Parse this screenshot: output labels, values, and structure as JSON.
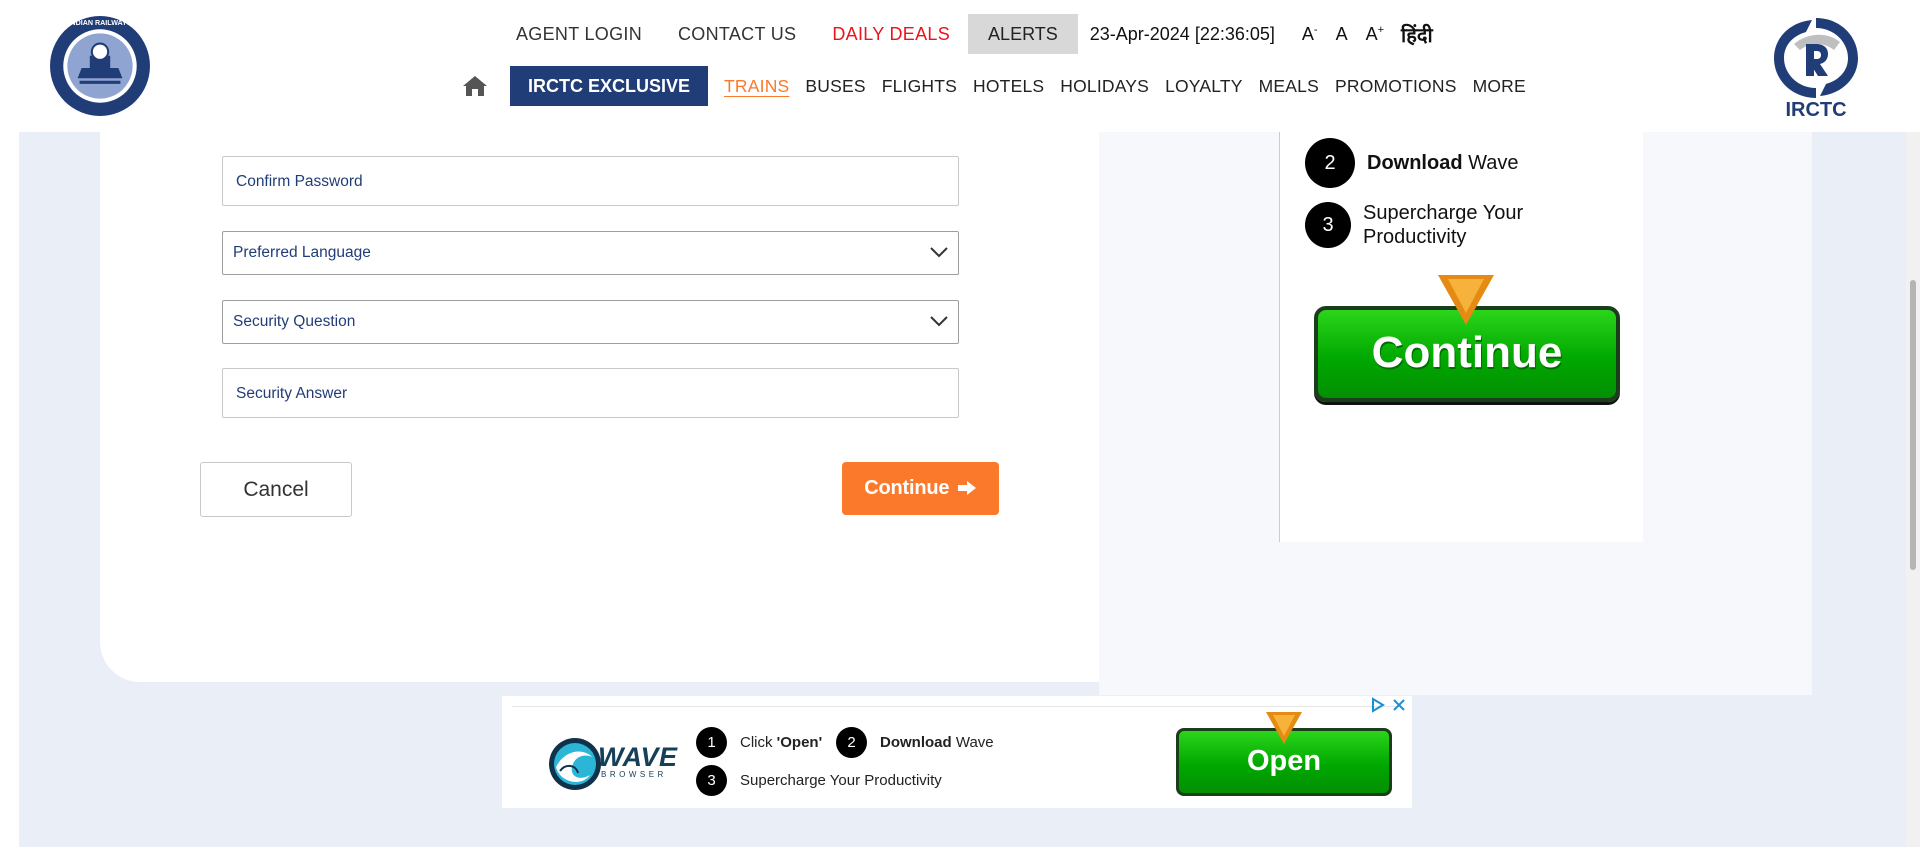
{
  "header": {
    "top_links": [
      "AGENT LOGIN",
      "CONTACT US",
      "DAILY DEALS"
    ],
    "alerts_label": "ALERTS",
    "datetime": "23-Apr-2024 [22:36:05]",
    "font_small": "A",
    "font_small_sup": "-",
    "font_normal": "A",
    "font_large": "A",
    "font_large_sup": "+",
    "hindi_label": "हिंदी",
    "exclusive_label": "IRCTC EXCLUSIVE",
    "nav_items": [
      "TRAINS",
      "BUSES",
      "FLIGHTS",
      "HOTELS",
      "HOLIDAYS",
      "LOYALTY",
      "MEALS",
      "PROMOTIONS",
      "MORE"
    ],
    "active_nav": "TRAINS",
    "left_logo_text": "INDIAN RAILWAYS",
    "right_logo_text": "IRCTC"
  },
  "form": {
    "confirm_password_placeholder": "Confirm Password",
    "preferred_language_placeholder": "Preferred Language",
    "security_question_placeholder": "Security Question",
    "security_answer_placeholder": "Security Answer",
    "cancel_label": "Cancel",
    "continue_label": "Continue"
  },
  "side_ad": {
    "step2_num": "2",
    "step2_bold": "Download",
    "step2_rest": "Wave",
    "step3_num": "3",
    "step3_text": "Supercharge Your Productivity",
    "button_label": "Continue"
  },
  "banner": {
    "brand": "WAVE",
    "brand_sub": "BROWSER",
    "step1_num": "1",
    "step1_pre": "Click",
    "step1_bold": "'Open'",
    "step2_num": "2",
    "step2_bold": "Download",
    "step2_rest": "Wave",
    "step3_num": "3",
    "step3_text": "Supercharge Your Productivity",
    "button_label": "Open"
  },
  "colors": {
    "brand_navy": "#213d77",
    "accent_orange": "#fb792b",
    "deals_red": "#e8151c",
    "ad_green": "#00a800"
  }
}
